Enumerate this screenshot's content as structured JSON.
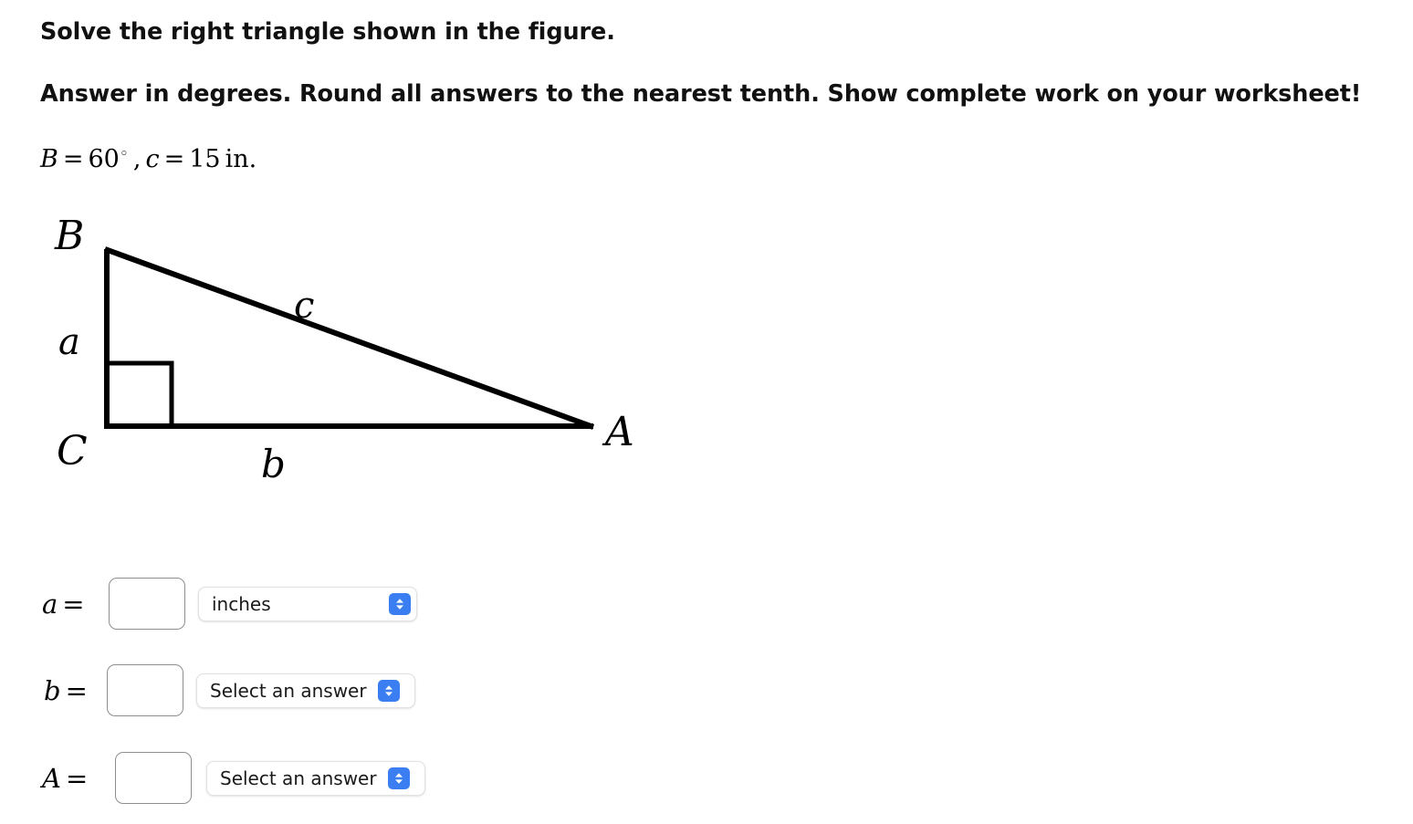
{
  "problem": {
    "line1": "Solve the right triangle shown in the figure.",
    "line2": "Answer in degrees. Round all answers to the nearest tenth. Show complete work on your worksheet!",
    "given": {
      "angle_var": "B",
      "equals": "=",
      "angle_value": "60",
      "degree_symbol": "◦",
      "comma": ",",
      "side_var": "c",
      "side_value": "15",
      "unit": "in."
    }
  },
  "figure": {
    "vertex_B": "B",
    "vertex_C": "C",
    "vertex_A": "A",
    "side_a": "a",
    "side_b": "b",
    "side_c": "c",
    "stroke_color": "#000000"
  },
  "answers": {
    "rows": [
      {
        "label_var": "a",
        "label_eq": "=",
        "input_value": "",
        "input_placeholder": "",
        "select_value": "inches"
      },
      {
        "label_var": "b",
        "label_eq": "=",
        "input_value": "",
        "input_placeholder": "",
        "select_value": "Select an answer"
      },
      {
        "label_var": "A",
        "label_eq": "=",
        "input_value": "",
        "input_placeholder": "",
        "select_value": "Select an answer"
      }
    ]
  },
  "colors": {
    "select_accent": "#3b7ef2",
    "input_border": "#8e8e8e",
    "background": "#ffffff"
  }
}
